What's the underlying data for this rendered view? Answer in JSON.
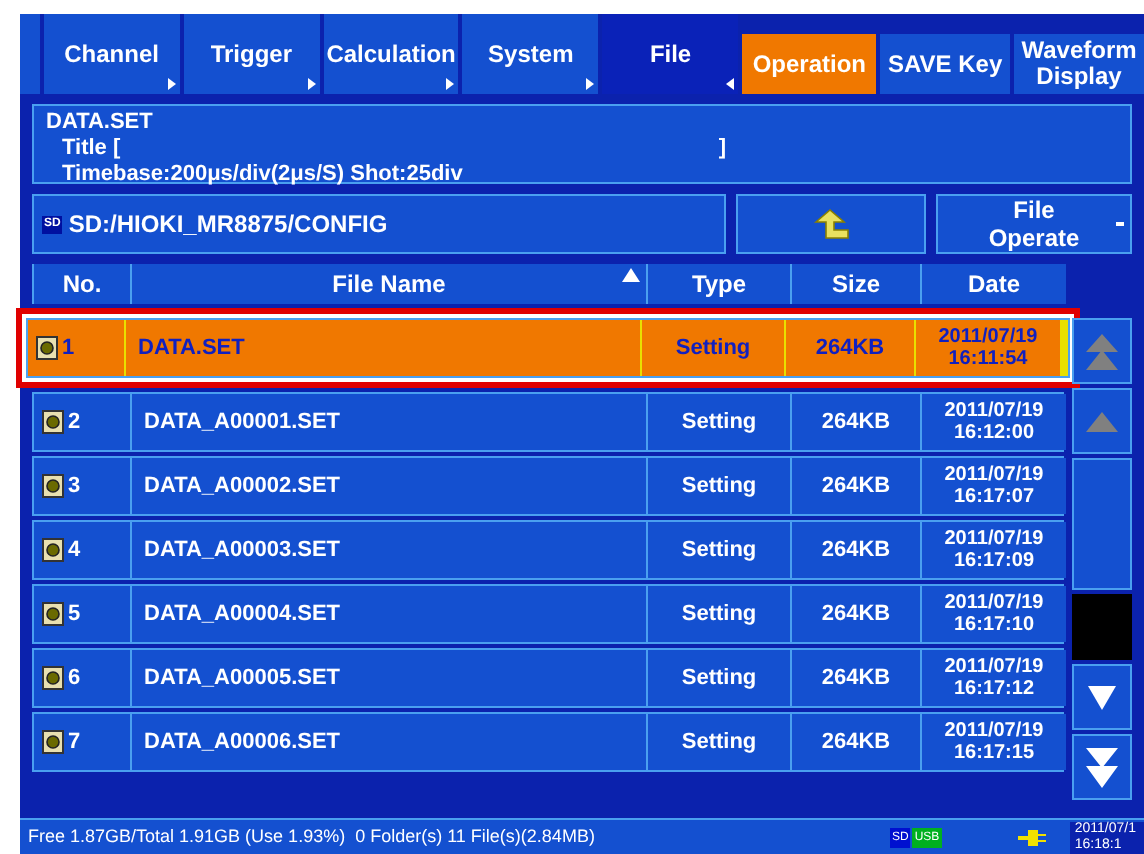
{
  "tabs": [
    {
      "label": "Channel",
      "selected": false
    },
    {
      "label": "Trigger",
      "selected": false
    },
    {
      "label": "Calculation",
      "selected": false
    },
    {
      "label": "System",
      "selected": false
    },
    {
      "label": "File",
      "selected": true
    }
  ],
  "subtabs": [
    {
      "label": "Operation",
      "selected": true
    },
    {
      "label": "SAVE Key",
      "selected": false
    },
    {
      "label": "Waveform\nDisplay",
      "selected": false
    }
  ],
  "info": {
    "file": "DATA.SET",
    "title_open": "Title [",
    "title_close": "]",
    "timebase": "Timebase:200μs/div(2μs/S) Shot:25div"
  },
  "path": {
    "drive_badge": "SD",
    "text": "SD:/HIOKI_MR8875/CONFIG"
  },
  "file_operate": "File\nOperate",
  "columns": [
    "No.",
    "File Name",
    "Type",
    "Size",
    "Date"
  ],
  "rows": [
    {
      "no": "1",
      "name": "DATA.SET",
      "type": "Setting",
      "size": "264KB",
      "date": "2011/07/19",
      "time": "16:11:54",
      "selected": true
    },
    {
      "no": "2",
      "name": "DATA_A00001.SET",
      "type": "Setting",
      "size": "264KB",
      "date": "2011/07/19",
      "time": "16:12:00",
      "selected": false
    },
    {
      "no": "3",
      "name": "DATA_A00002.SET",
      "type": "Setting",
      "size": "264KB",
      "date": "2011/07/19",
      "time": "16:17:07",
      "selected": false
    },
    {
      "no": "4",
      "name": "DATA_A00003.SET",
      "type": "Setting",
      "size": "264KB",
      "date": "2011/07/19",
      "time": "16:17:09",
      "selected": false
    },
    {
      "no": "5",
      "name": "DATA_A00004.SET",
      "type": "Setting",
      "size": "264KB",
      "date": "2011/07/19",
      "time": "16:17:10",
      "selected": false
    },
    {
      "no": "6",
      "name": "DATA_A00005.SET",
      "type": "Setting",
      "size": "264KB",
      "date": "2011/07/19",
      "time": "16:17:12",
      "selected": false
    },
    {
      "no": "7",
      "name": "DATA_A00006.SET",
      "type": "Setting",
      "size": "264KB",
      "date": "2011/07/19",
      "time": "16:17:15",
      "selected": false
    }
  ],
  "status": {
    "text": "Free 1.87GB/Total 1.91GB (Use 1.93%)  0 Folder(s) 11 File(s)(2.84MB)",
    "sd_badge": "SD",
    "usb_badge": "USB",
    "clock_date": "2011/07/1",
    "clock_time": "16:18:1"
  }
}
